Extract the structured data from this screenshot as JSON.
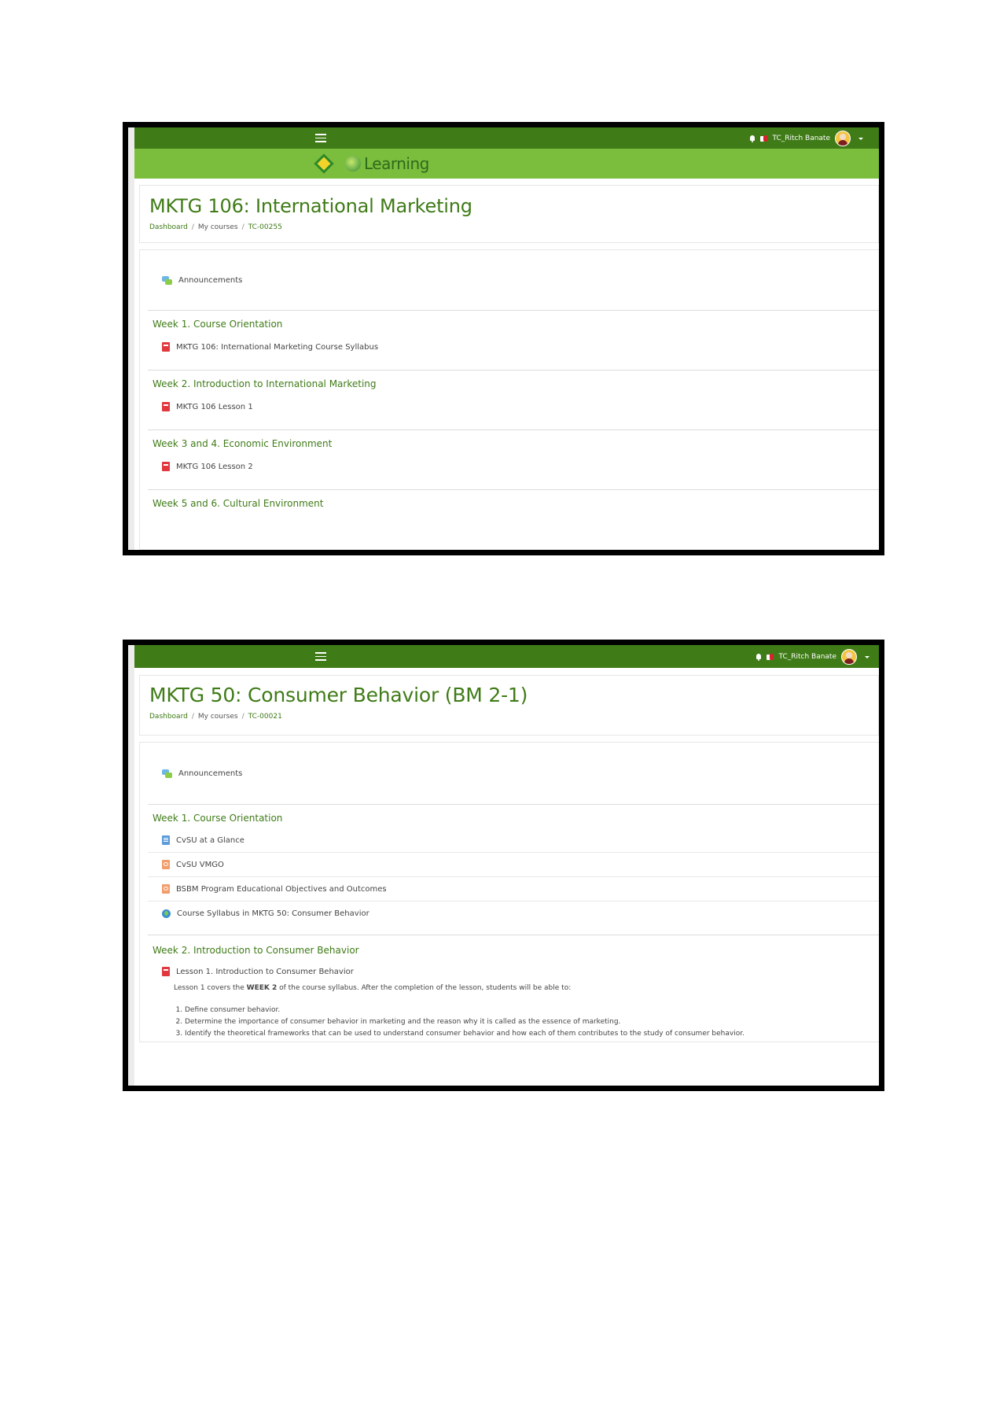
{
  "screenshot1": {
    "user": {
      "name": "TC_Ritch Banate"
    },
    "brand": {
      "logo_text": "Learning"
    },
    "course_title": "MKTG 106: International Marketing",
    "breadcrumb": {
      "dashboard": "Dashboard",
      "my_courses": "My courses",
      "course_id": "TC-00255",
      "separator": "/"
    },
    "announcements_label": "Announcements",
    "sections": [
      {
        "title": "Week 1. Course Orientation",
        "activity": "MKTG 106: International Marketing Course Syllabus"
      },
      {
        "title": "Week 2. Introduction to International Marketing",
        "activity": "MKTG 106 Lesson 1"
      },
      {
        "title": "Week 3 and 4. Economic Environment",
        "activity": "MKTG 106 Lesson 2"
      },
      {
        "title": "Week 5 and 6. Cultural Environment"
      }
    ]
  },
  "screenshot2": {
    "user": {
      "name": "TC_Ritch Banate"
    },
    "course_title": "MKTG 50: Consumer Behavior (BM 2-1)",
    "breadcrumb": {
      "dashboard": "Dashboard",
      "my_courses": "My courses",
      "course_id": "TC-00021",
      "separator": "/"
    },
    "announcements_label": "Announcements",
    "week1": {
      "title": "Week 1. Course Orientation",
      "activities": [
        "CvSU at a Glance",
        "CvSU VMGO",
        "BSBM Program Educational Objectives and Outcomes",
        "Course Syllabus in MKTG 50: Consumer Behavior"
      ]
    },
    "week2": {
      "title": "Week 2. Introduction to Consumer Behavior",
      "activity": "Lesson 1. Introduction to Consumer Behavior",
      "intro_before": "Lesson 1 covers the ",
      "intro_bold": "WEEK 2",
      "intro_after": " of the course syllabus. After the completion of the lesson, students will be able to:",
      "objectives": [
        "Define consumer behavior.",
        "Determine the importance of consumer behavior in marketing and the reason why it is called as the essence of marketing.",
        "Identify the theoretical frameworks that can be used to understand consumer behavior and how each of them contributes to the study of consumer behavior."
      ]
    }
  }
}
